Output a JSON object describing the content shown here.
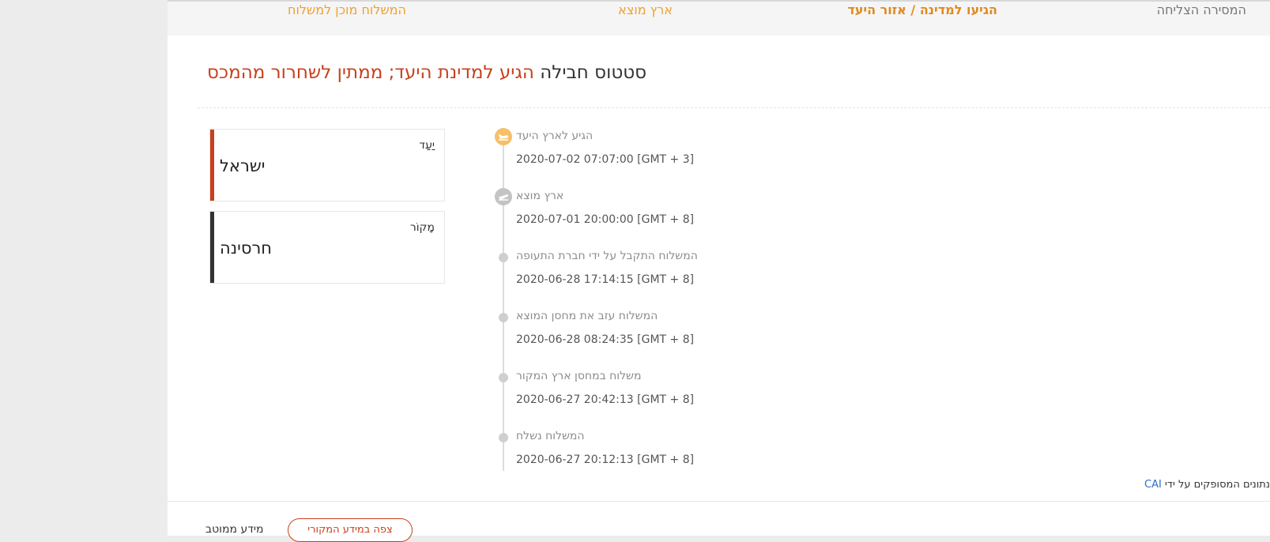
{
  "tabs": [
    {
      "label": "המסירה הצליחה",
      "state": "inactive"
    },
    {
      "label": "הגיעו למדינה / אזור היעד",
      "state": "active"
    },
    {
      "label": "ארץ מוצא",
      "state": "done"
    },
    {
      "label": "המשלוח מוכן למשלוח",
      "state": "done"
    }
  ],
  "status": {
    "prefix": "סטטוס חבילה",
    "value": "הגיע למדינת היעד; ממתין לשחרור מהמכס"
  },
  "cards": {
    "destination": {
      "label": "יַעַד",
      "value": "ישראל"
    },
    "origin": {
      "label": "מָקוֹר",
      "value": "חרסינה"
    }
  },
  "timeline": [
    {
      "event": "הגיע לארץ היעד",
      "date": "2020-07-02 07:07:00 [GMT + 3]",
      "icon": "plane-landing-icon"
    },
    {
      "event": "ארץ מוצא",
      "date": "2020-07-01 20:00:00 [GMT + 8]",
      "icon": "plane-departure-icon"
    },
    {
      "event": "המשלוח התקבל על ידי חברת התעופה",
      "date": "2020-06-28 17:14:15 [GMT + 8]",
      "icon": "dot"
    },
    {
      "event": "המשלוח עזב את מחסן המוצא",
      "date": "2020-06-28 08:24:35 [GMT + 8]",
      "icon": "dot"
    },
    {
      "event": "משלוח במחסן ארץ המקור",
      "date": "2020-06-27 20:42:13 [GMT + 8]",
      "icon": "dot"
    },
    {
      "event": "המשלוח נשלח",
      "date": "2020-06-27 20:12:13 [GMT + 8]",
      "icon": "dot"
    }
  ],
  "provider": {
    "text": "נתונים המסופקים על ידי",
    "name": "CAI"
  },
  "footer": {
    "view_original": "צפה במידע המקורי",
    "optimized": "מידע ממוטב"
  },
  "colors": {
    "accent": "#f0a030",
    "active_tab": "#e08a1e",
    "inactive_tab": "#777777",
    "status_red": "#c8401c",
    "destination_bar": "#c8401c",
    "origin_bar": "#333333",
    "landing_icon_bg": "#f5c06a",
    "departure_icon_bg": "#c4c4c4"
  }
}
